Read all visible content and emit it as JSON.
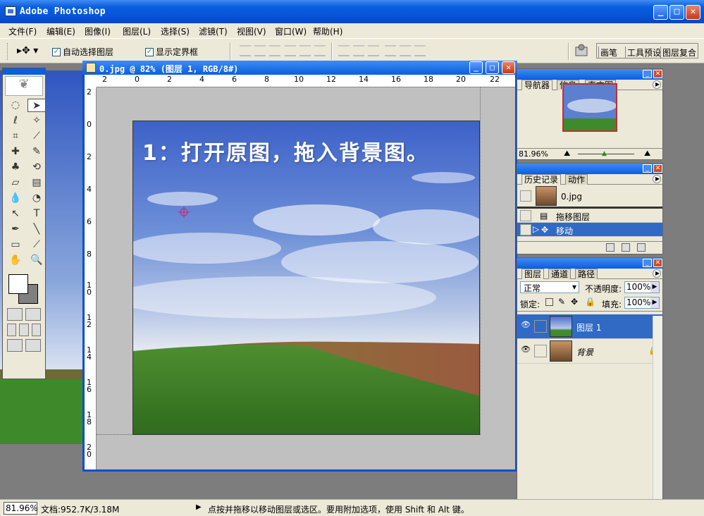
{
  "window": {
    "title": "Adobe Photoshop",
    "min": "_",
    "max": "□",
    "close": "✕"
  },
  "menu": [
    "文件(F)",
    "编辑(E)",
    "图像(I)",
    "图层(L)",
    "选择(S)",
    "滤镜(T)",
    "视图(V)",
    "窗口(W)",
    "帮助(H)"
  ],
  "options": {
    "auto_select_layer": "自动选择图层",
    "show_bounding_box": "显示定界框",
    "check": "✓"
  },
  "palette_well": [
    "画笔",
    "工具预设",
    "图层复合"
  ],
  "document": {
    "title": "0.jpg @ 82% (图层 1, RGB/8#)",
    "canvas_caption": "1：打开原图，拖入背景图。",
    "ruler_h": [
      "18",
      "2",
      "0",
      "2",
      "4",
      "6",
      "8",
      "10",
      "12",
      "14",
      "16",
      "18",
      "20",
      "22"
    ],
    "ruler_v": [
      "2",
      "0",
      "2",
      "4",
      "6",
      "8",
      "1\n0",
      "1\n2",
      "1\n4",
      "1\n6",
      "1\n8",
      "2\n0"
    ]
  },
  "navigator": {
    "tabs": [
      "导航器",
      "信息",
      "直方图"
    ],
    "zoom": "81.96%"
  },
  "history": {
    "tabs": [
      "历史记录",
      "动作"
    ],
    "snapshot": "0.jpg",
    "items": [
      "拖移图层",
      "移动"
    ]
  },
  "layers": {
    "tabs": [
      "图层",
      "通道",
      "路径"
    ],
    "blend_mode": "正常",
    "opacity_label": "不透明度:",
    "opacity": "100%",
    "lock_label": "锁定:",
    "fill_label": "填充:",
    "fill": "100%",
    "items": [
      {
        "name": "图层 1",
        "active": true
      },
      {
        "name": "背景",
        "active": false
      }
    ]
  },
  "status": {
    "zoom": "81.96%",
    "doc_size": "文档:952.7K/3.18M",
    "hint": "点按并拖移以移动图层或选区。要用附加选项，使用 Shift 和 Alt 键。"
  },
  "colors": {
    "xp_blue": "#0a5ee0",
    "panel_bg": "#ece9d8",
    "selection": "#316ac5"
  }
}
